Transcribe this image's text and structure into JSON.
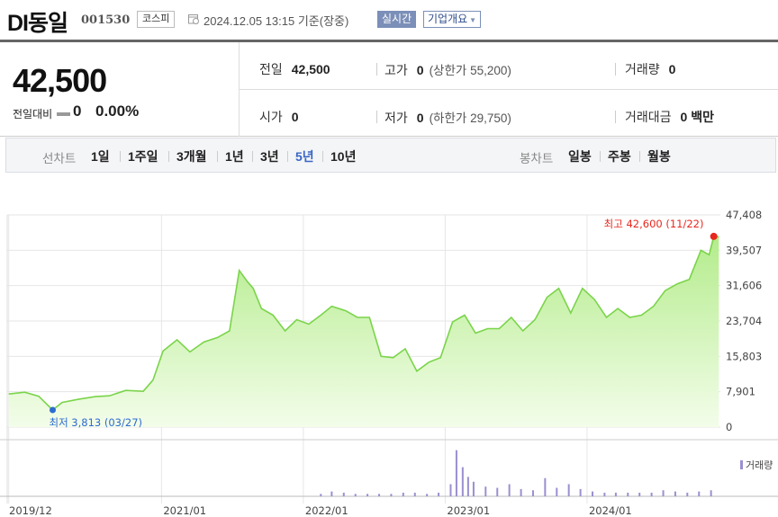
{
  "header": {
    "stock_name": "DI동일",
    "stock_code": "001530",
    "market": "코스피",
    "datetime": "2024.12.05 13:15 기준(장중)",
    "realtime": "실시간",
    "company_info": "기업개요"
  },
  "summary": {
    "price": "42,500",
    "change_label": "전일대비",
    "change_value": "0",
    "change_pct": "0.00%",
    "prev_close": {
      "label": "전일",
      "value": "42,500"
    },
    "open": {
      "label": "시가",
      "value": "0"
    },
    "high": {
      "label": "고가",
      "value": "0",
      "limit": "(상한가 55,200)"
    },
    "low": {
      "label": "저가",
      "value": "0",
      "limit": "(하한가 29,750)"
    },
    "volume": {
      "label": "거래량",
      "value": "0"
    },
    "amount": {
      "label": "거래대금",
      "value": "0 백만"
    }
  },
  "period_bar": {
    "line_label": "선차트",
    "line_periods": [
      "1일",
      "1주일",
      "3개월",
      "1년",
      "3년",
      "5년",
      "10년"
    ],
    "active_period": "5년",
    "candle_label": "봉차트",
    "candle_periods": [
      "일봉",
      "주봉",
      "월봉"
    ]
  },
  "colors": {
    "line": "#7ad44a",
    "fill_top": "#b4ec8c",
    "fill_bottom": "#f3fdea",
    "volume": "#9b8fd0",
    "high_marker": "#e8271e",
    "low_marker": "#2c6bd1",
    "active_period": "#3a66c4"
  },
  "chart_data": {
    "type": "area",
    "y_ticks": [
      "47,408",
      "39,507",
      "31,606",
      "23,704",
      "15,803",
      "7,901",
      "0"
    ],
    "ylim": [
      0,
      47408
    ],
    "x_ticks": [
      "2019/12",
      "2021/01",
      "2022/01",
      "2023/01",
      "2024/01"
    ],
    "grid": true,
    "high_annotation": "최고 42,600 (11/22)",
    "low_annotation": "최저 3,813 (03/27)",
    "volume_legend": "거래량",
    "series": [
      {
        "x": [
          "2019-12-05",
          "2020-01-15",
          "2020-02-20",
          "2020-03-27",
          "2020-04-20",
          "2020-06-01",
          "2020-07-15",
          "2020-08-20",
          "2020-10-01",
          "2020-11-15",
          "2020-12-10",
          "2021-01-05",
          "2021-02-10",
          "2021-03-15",
          "2021-04-20",
          "2021-05-25",
          "2021-06-25",
          "2021-07-20",
          "2021-08-10",
          "2021-08-25",
          "2021-09-15",
          "2021-10-15",
          "2021-11-15",
          "2021-12-15",
          "2022-01-15",
          "2022-02-15",
          "2022-03-15",
          "2022-04-20",
          "2022-05-20",
          "2022-06-20",
          "2022-07-20",
          "2022-08-20",
          "2022-09-20",
          "2022-10-20",
          "2022-11-20",
          "2022-12-20",
          "2023-01-20",
          "2023-02-20",
          "2023-03-20",
          "2023-04-20",
          "2023-05-20",
          "2023-06-20",
          "2023-07-20",
          "2023-08-20",
          "2023-09-20",
          "2023-10-20",
          "2023-11-20",
          "2023-12-20",
          "2024-01-20",
          "2024-02-20",
          "2024-03-20",
          "2024-04-20",
          "2024-05-20",
          "2024-06-20",
          "2024-07-20",
          "2024-08-20",
          "2024-09-20",
          "2024-10-20",
          "2024-11-10",
          "2024-11-22",
          "2024-12-05"
        ],
        "values": [
          7400,
          7800,
          6900,
          3813,
          5500,
          6200,
          6800,
          7000,
          8200,
          8000,
          10500,
          17000,
          19500,
          16800,
          19000,
          20000,
          21500,
          35000,
          32500,
          31000,
          26500,
          25000,
          21500,
          24000,
          23000,
          25000,
          27000,
          26000,
          24500,
          24500,
          15800,
          15500,
          17500,
          12500,
          14500,
          15500,
          23500,
          25000,
          21000,
          22000,
          22000,
          24500,
          21500,
          24000,
          29000,
          31000,
          25500,
          31000,
          28500,
          24500,
          26500,
          24500,
          25000,
          27000,
          30500,
          32000,
          33000,
          39500,
          38500,
          42600,
          42500
        ]
      }
    ],
    "volume": {
      "x": [
        "2022-02-15",
        "2022-03-15",
        "2022-04-15",
        "2022-05-15",
        "2022-06-15",
        "2022-07-15",
        "2022-08-15",
        "2022-09-15",
        "2022-10-15",
        "2022-11-15",
        "2022-12-15",
        "2023-01-15",
        "2023-01-30",
        "2023-02-15",
        "2023-03-01",
        "2023-03-15",
        "2023-04-15",
        "2023-05-15",
        "2023-06-15",
        "2023-07-15",
        "2023-08-15",
        "2023-09-15",
        "2023-10-15",
        "2023-11-15",
        "2023-12-15",
        "2024-01-15",
        "2024-02-15",
        "2024-03-15",
        "2024-04-15",
        "2024-05-15",
        "2024-06-15",
        "2024-07-15",
        "2024-08-15",
        "2024-09-15",
        "2024-10-15",
        "2024-11-15"
      ],
      "values": [
        2,
        4,
        3,
        2,
        2,
        2,
        2,
        3,
        3,
        2,
        3,
        10,
        38,
        24,
        16,
        12,
        8,
        7,
        10,
        6,
        5,
        15,
        7,
        10,
        6,
        4,
        3,
        3,
        3,
        3,
        3,
        5,
        4,
        3,
        4,
        5
      ]
    }
  }
}
